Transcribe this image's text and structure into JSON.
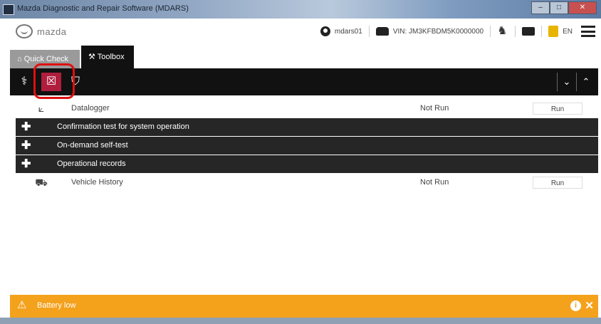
{
  "window": {
    "title": "Mazda Diagnostic and Repair Software (MDARS)",
    "minimize_label": "–",
    "maximize_label": "□",
    "close_label": "✕"
  },
  "brand": {
    "logo_text": "mazda"
  },
  "top": {
    "user": "mdars01",
    "vin": "VIN: JM3KFBDM5K0000000",
    "lang": "EN"
  },
  "tabs": [
    {
      "label": "Quick Check"
    },
    {
      "label": "Toolbox"
    }
  ],
  "toolstrip": {
    "icons": [
      "stethoscope-icon",
      "module-icon",
      "lock-icon"
    ],
    "expand_all": "⌄",
    "collapse_all": "⌃"
  },
  "list": [
    {
      "type": "item",
      "icon": "chart-icon",
      "name": "Datalogger",
      "status": "Not Run",
      "button": "Run"
    },
    {
      "type": "group",
      "name": "Confirmation test for system operation"
    },
    {
      "type": "group",
      "name": "On-demand self-test"
    },
    {
      "type": "group",
      "name": "Operational records"
    },
    {
      "type": "item",
      "icon": "car-history-icon",
      "name": "Vehicle History",
      "status": "Not Run",
      "button": "Run"
    }
  ],
  "notification": {
    "message": "Battery low"
  },
  "colors": {
    "accent": "#b01e3e",
    "warning": "#f4a11c",
    "dark": "#111111"
  }
}
